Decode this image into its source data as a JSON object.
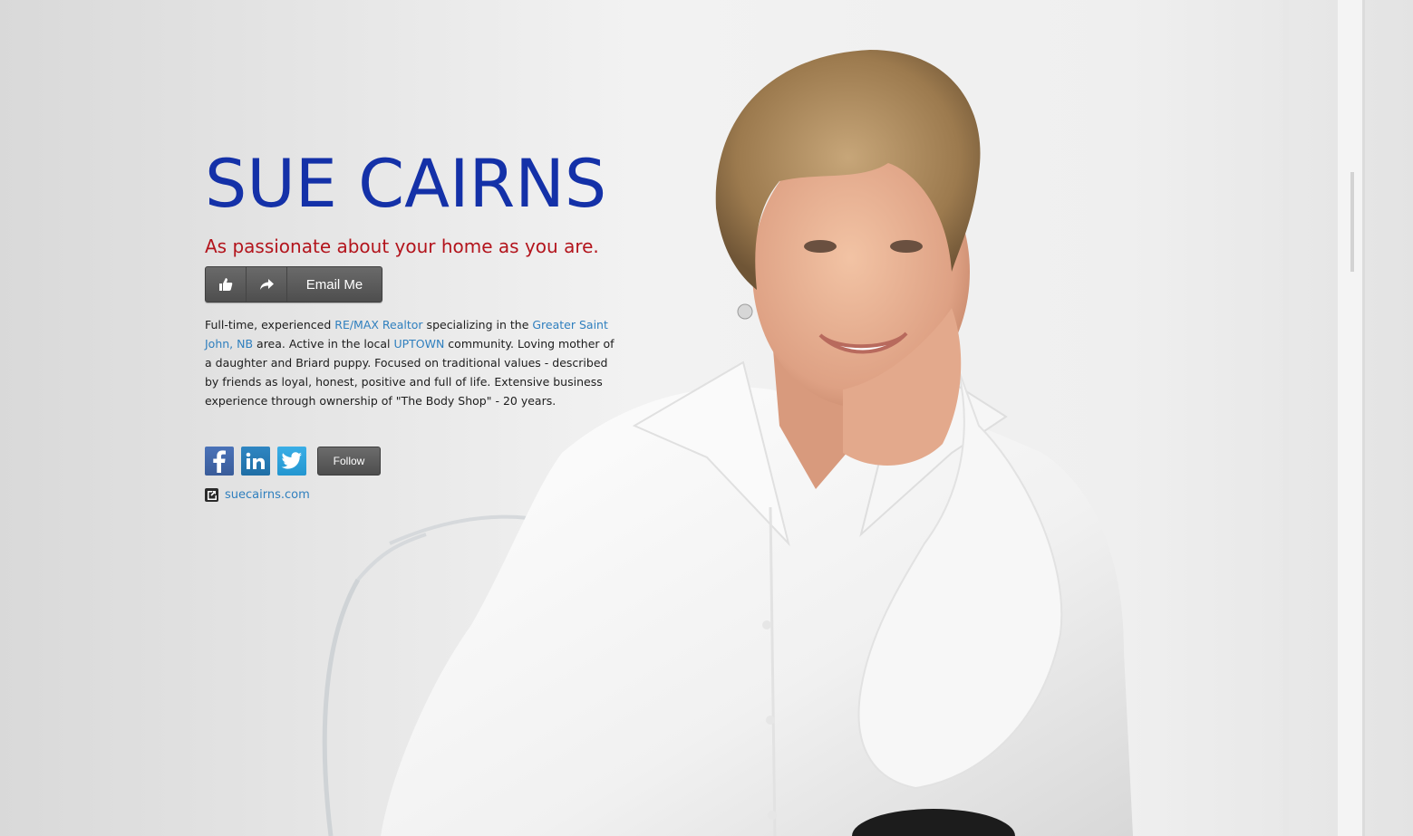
{
  "profile": {
    "name": "SUE CAIRNS",
    "headline": "As passionate about your home as you are.",
    "buttons": {
      "like_icon": "thumbs-up-icon",
      "share_icon": "share-arrow-icon",
      "email_label": "Email Me"
    },
    "bio": {
      "t1": "Full-time, experienced ",
      "link1": "RE/MAX Realtor",
      "t2": " specializing in the ",
      "link2": "Greater Saint John, NB",
      "t3": " area.  Active in the local ",
      "link3": "UPTOWN",
      "t4": " community. Loving mother of a daughter and Briard puppy.  Focused on traditional values - described by friends as loyal, honest, positive and full of life. Extensive business experience through ownership of \"The Body Shop\" - 20 years."
    },
    "social": {
      "facebook_icon": "facebook-icon",
      "linkedin_icon": "linkedin-icon",
      "twitter_icon": "twitter-icon",
      "follow_label": "Follow"
    },
    "website": {
      "icon": "external-link-icon",
      "label": "suecairns.com"
    }
  },
  "colors": {
    "name": "#1431a8",
    "headline": "#b3141c",
    "link": "#2f7fbe",
    "button": "#5a5a5a"
  }
}
